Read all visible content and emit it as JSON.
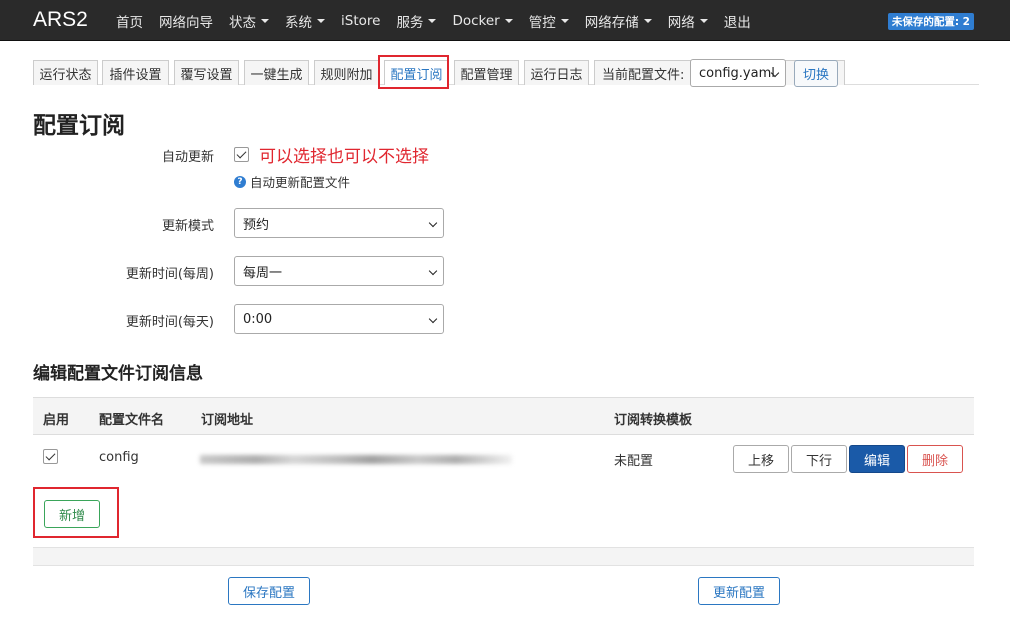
{
  "topbar": {
    "brand": "ARS2",
    "nav": [
      {
        "label": "首页",
        "dropdown": false
      },
      {
        "label": "网络向导",
        "dropdown": false
      },
      {
        "label": "状态",
        "dropdown": true
      },
      {
        "label": "系统",
        "dropdown": true
      },
      {
        "label": "iStore",
        "dropdown": false
      },
      {
        "label": "服务",
        "dropdown": true
      },
      {
        "label": "Docker",
        "dropdown": true
      },
      {
        "label": "管控",
        "dropdown": true
      },
      {
        "label": "网络存储",
        "dropdown": true
      },
      {
        "label": "网络",
        "dropdown": true
      },
      {
        "label": "退出",
        "dropdown": false
      }
    ],
    "unsaved_badge": "未保存的配置: 2"
  },
  "tabs": {
    "items": [
      "运行状态",
      "插件设置",
      "覆写设置",
      "一键生成",
      "规则附加",
      "配置订阅",
      "配置管理",
      "运行日志",
      "当前配置文件:"
    ],
    "active": "配置订阅",
    "config_select_value": "config.yaml",
    "switch_label": "切换"
  },
  "page": {
    "title": "配置订阅",
    "auto_update_label": "自动更新",
    "auto_update_checked": true,
    "annotation": "可以选择也可以不选择",
    "help_text": "自动更新配置文件",
    "update_mode_label": "更新模式",
    "update_mode_value": "预约",
    "weekly_label": "更新时间(每周)",
    "weekly_value": "每周一",
    "daily_label": "更新时间(每天)",
    "daily_value": "0:00"
  },
  "subscription": {
    "title": "编辑配置文件订阅信息",
    "headers": {
      "enable": "启用",
      "name": "配置文件名",
      "url": "订阅地址",
      "template": "订阅转换模板"
    },
    "rows": [
      {
        "enabled": true,
        "name": "config",
        "template": "未配置"
      }
    ],
    "row_buttons": {
      "up": "上移",
      "down": "下行",
      "edit": "编辑",
      "delete": "删除"
    },
    "add_label": "新增"
  },
  "footer": {
    "save_label": "保存配置",
    "update_label": "更新配置"
  },
  "colors": {
    "topbar": "#2a2a2a",
    "accent": "#2b77c2",
    "highlight": "#e0262f",
    "primary_button": "#1a5aa8",
    "danger": "#d9534f",
    "success": "#3aa55a"
  }
}
